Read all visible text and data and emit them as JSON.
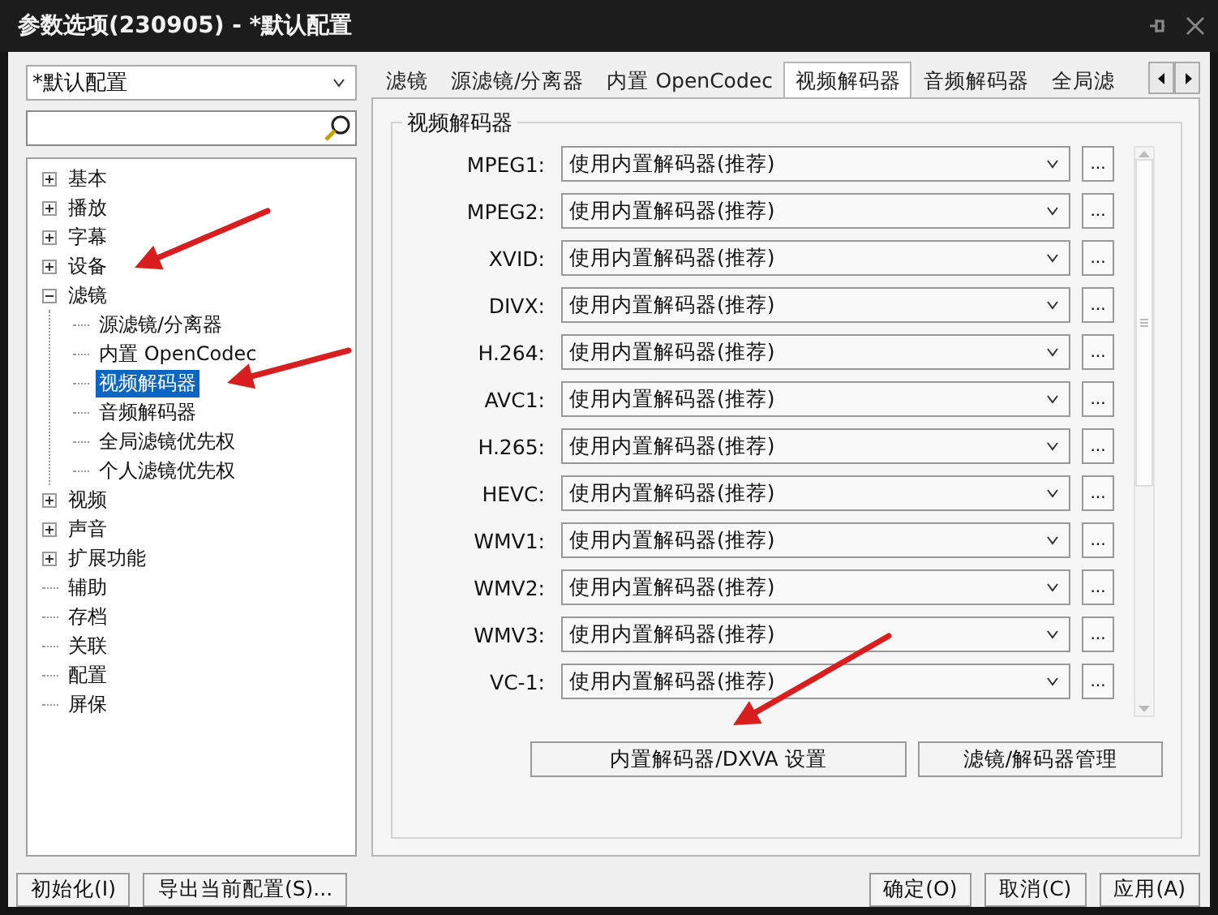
{
  "window": {
    "title": "参数选项(230905) - *默认配置"
  },
  "profile_select": {
    "value": "*默认配置"
  },
  "tree": [
    {
      "label": "基本",
      "kind": "folder",
      "expanded": false,
      "selected": false
    },
    {
      "label": "播放",
      "kind": "folder",
      "expanded": false,
      "selected": false
    },
    {
      "label": "字幕",
      "kind": "folder",
      "expanded": false,
      "selected": false
    },
    {
      "label": "设备",
      "kind": "folder",
      "expanded": false,
      "selected": false
    },
    {
      "label": "滤镜",
      "kind": "folder",
      "expanded": true,
      "selected": false,
      "children": [
        {
          "label": "源滤镜/分离器",
          "selected": false
        },
        {
          "label": "内置 OpenCodec",
          "selected": false
        },
        {
          "label": "视频解码器",
          "selected": true
        },
        {
          "label": "音频解码器",
          "selected": false
        },
        {
          "label": "全局滤镜优先权",
          "selected": false
        },
        {
          "label": "个人滤镜优先权",
          "selected": false
        }
      ]
    },
    {
      "label": "视频",
      "kind": "folder",
      "expanded": false,
      "selected": false
    },
    {
      "label": "声音",
      "kind": "folder",
      "expanded": false,
      "selected": false
    },
    {
      "label": "扩展功能",
      "kind": "folder",
      "expanded": false,
      "selected": false
    },
    {
      "label": "辅助",
      "kind": "leaf",
      "selected": false
    },
    {
      "label": "存档",
      "kind": "leaf",
      "selected": false
    },
    {
      "label": "关联",
      "kind": "leaf",
      "selected": false
    },
    {
      "label": "配置",
      "kind": "leaf",
      "selected": false
    },
    {
      "label": "屏保",
      "kind": "leaf",
      "selected": false
    }
  ],
  "tabs": [
    {
      "label": "滤镜",
      "selected": false
    },
    {
      "label": "源滤镜/分离器",
      "selected": false
    },
    {
      "label": "内置 OpenCodec",
      "selected": false
    },
    {
      "label": "视频解码器",
      "selected": true
    },
    {
      "label": "音频解码器",
      "selected": false
    },
    {
      "label": "全局滤",
      "selected": false
    }
  ],
  "group": {
    "title": "视频解码器",
    "rows": [
      {
        "label": "MPEG1:",
        "value": "使用内置解码器(推荐)",
        "button": "..."
      },
      {
        "label": "MPEG2:",
        "value": "使用内置解码器(推荐)",
        "button": "..."
      },
      {
        "label": "XVID:",
        "value": "使用内置解码器(推荐)",
        "button": "..."
      },
      {
        "label": "DIVX:",
        "value": "使用内置解码器(推荐)",
        "button": "..."
      },
      {
        "label": "H.264:",
        "value": "使用内置解码器(推荐)",
        "button": "..."
      },
      {
        "label": "AVC1:",
        "value": "使用内置解码器(推荐)",
        "button": "..."
      },
      {
        "label": "H.265:",
        "value": "使用内置解码器(推荐)",
        "button": "..."
      },
      {
        "label": "HEVC:",
        "value": "使用内置解码器(推荐)",
        "button": "..."
      },
      {
        "label": "WMV1:",
        "value": "使用内置解码器(推荐)",
        "button": "..."
      },
      {
        "label": "WMV2:",
        "value": "使用内置解码器(推荐)",
        "button": "..."
      },
      {
        "label": "WMV3:",
        "value": "使用内置解码器(推荐)",
        "button": "..."
      },
      {
        "label": "VC-1:",
        "value": "使用内置解码器(推荐)",
        "button": "..."
      }
    ],
    "buttons": [
      "内置解码器/DXVA 设置",
      "滤镜/解码器管理"
    ]
  },
  "footer_left": [
    "初始化(I)",
    "导出当前配置(S)..."
  ],
  "footer_right": [
    "确定(O)",
    "取消(C)",
    "应用(A)"
  ]
}
